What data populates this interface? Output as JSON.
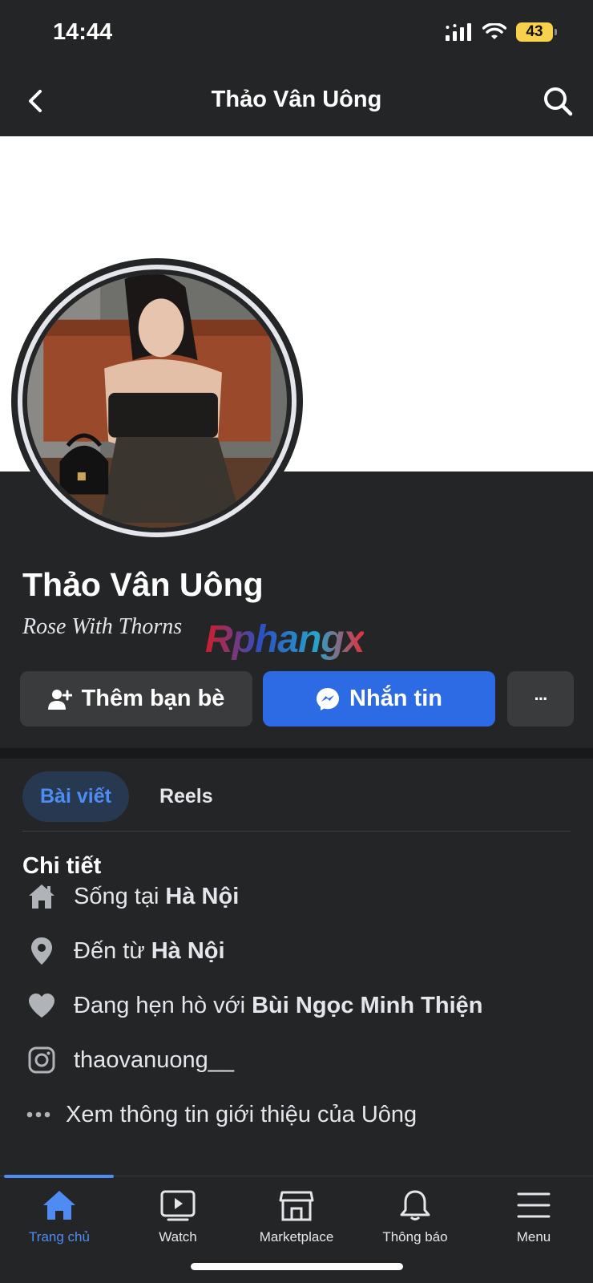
{
  "status_bar": {
    "time": "14:44",
    "battery": "43"
  },
  "top_nav": {
    "title": "Thảo Vân Uông"
  },
  "profile": {
    "name": "Thảo Vân Uông",
    "bio": "Rose With Thorns",
    "watermark": "Rphangx"
  },
  "actions": {
    "add_friend": "Thêm bạn bè",
    "message": "Nhắn tin",
    "more": "···"
  },
  "tabs": [
    {
      "label": "Bài viết",
      "active": true
    },
    {
      "label": "Reels",
      "active": false
    }
  ],
  "details": {
    "title": "Chi tiết",
    "items": [
      {
        "icon": "home-icon",
        "prefix": "Sống tại",
        "value": "Hà Nội"
      },
      {
        "icon": "location-pin-icon",
        "prefix": "Đến từ",
        "value": "Hà Nội"
      },
      {
        "icon": "heart-icon",
        "prefix": "Đang hẹn hò với",
        "value": "Bùi Ngọc Minh Thiện"
      },
      {
        "icon": "instagram-icon",
        "prefix": "thaovanuong__",
        "value": ""
      },
      {
        "icon": "more-dots-icon",
        "prefix": "Xem thông tin giới thiệu của Uông",
        "value": ""
      }
    ]
  },
  "bottom_nav": [
    {
      "label": "Trang chủ",
      "icon": "home-icon",
      "active": true
    },
    {
      "label": "Watch",
      "icon": "watch-icon",
      "active": false
    },
    {
      "label": "Marketplace",
      "icon": "marketplace-icon",
      "active": false
    },
    {
      "label": "Thông báo",
      "icon": "bell-icon",
      "active": false
    },
    {
      "label": "Menu",
      "icon": "menu-icon",
      "active": false
    }
  ],
  "colors": {
    "accent": "#2d6be4",
    "active_tab": "#4e8cf4",
    "background": "#242526"
  }
}
